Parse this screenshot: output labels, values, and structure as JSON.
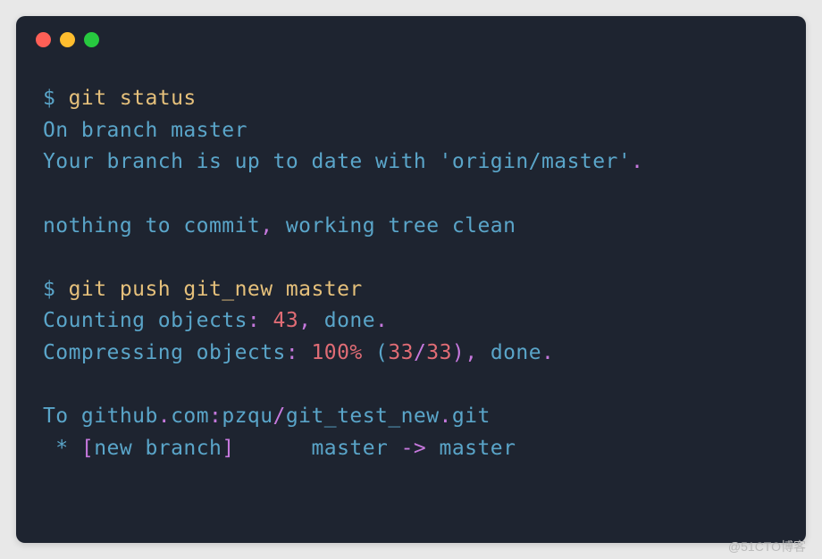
{
  "watermark": "@51CTO博客",
  "lines": {
    "l1_prompt": "$ ",
    "l1_cmd": "git status",
    "l2": "On branch master",
    "l3_a": "Your branch is up to date with ",
    "l3_b": "'origin/master'",
    "l3_c": ".",
    "l5_a": "nothing to commit",
    "l5_b": ", ",
    "l5_c": "working tree clean",
    "l7_prompt": "$ ",
    "l7_cmd": "git push git_new master",
    "l8_a": "Counting objects",
    "l8_b": ": ",
    "l8_c": "43",
    "l8_d": ", ",
    "l8_e": "done",
    "l8_f": ".",
    "l9_a": "Compressing objects",
    "l9_b": ": ",
    "l9_c": "100%",
    "l9_d": " (",
    "l9_e": "33",
    "l9_f": "/",
    "l9_g": "33",
    "l9_h": "), ",
    "l9_i": "done",
    "l9_j": ".",
    "l11_a": "To github",
    "l11_b": ".",
    "l11_c": "com",
    "l11_d": ":",
    "l11_e": "pzqu",
    "l11_f": "/",
    "l11_g": "git_test_new",
    "l11_h": ".",
    "l11_i": "git",
    "l12_a": " * ",
    "l12_b": "[",
    "l12_c": "new branch",
    "l12_d": "]",
    "l12_e": "      master ",
    "l12_f": "->",
    "l12_g": " master"
  }
}
